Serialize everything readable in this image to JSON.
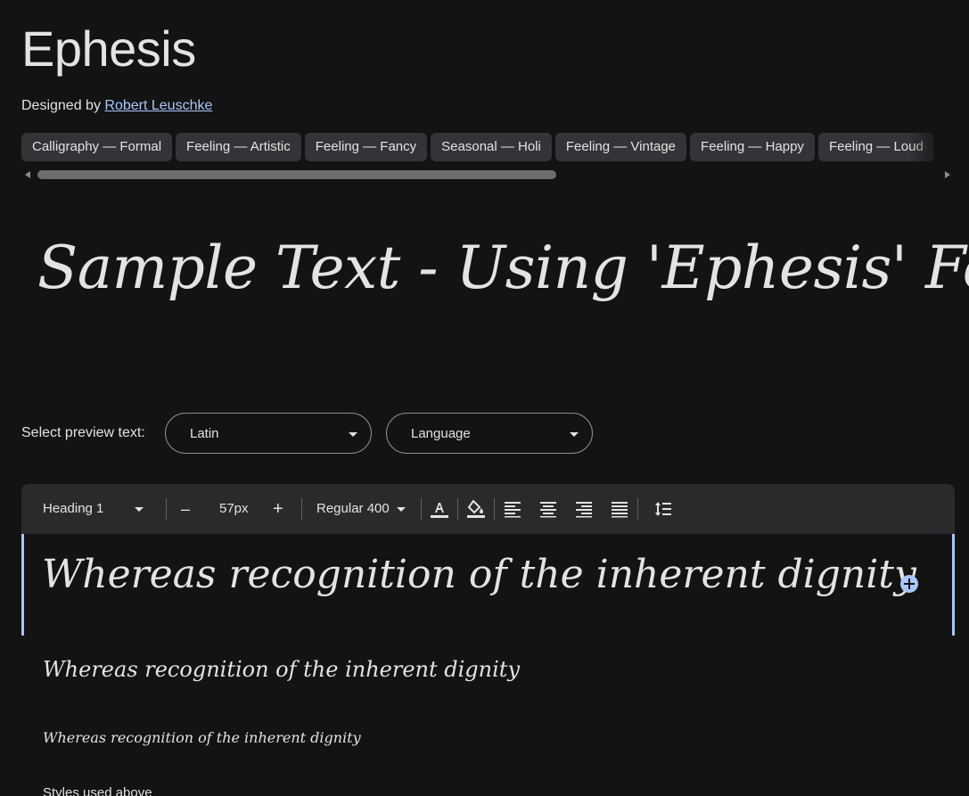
{
  "header": {
    "font_name": "Ephesis",
    "designed_by_label": "Designed by",
    "designer_name": "Robert Leuschke"
  },
  "tags": [
    "Calligraphy — Formal",
    "Feeling — Artistic",
    "Feeling — Fancy",
    "Seasonal — Holi",
    "Feeling — Vintage",
    "Feeling — Happy",
    "Feeling — Loud"
  ],
  "hero": {
    "sample_text": "Sample Text - Using 'Ephesis' Font."
  },
  "preview": {
    "label": "Select preview text:",
    "script_value": "Latin",
    "language_value": "Language"
  },
  "toolbar": {
    "style_value": "Heading 1",
    "decrease_symbol": "–",
    "size_value": "57px",
    "increase_symbol": "+",
    "weight_value": "Regular 400"
  },
  "editor": {
    "line_1": "Whereas recognition of the inherent dignity",
    "line_2": "Whereas recognition of the inherent dignity",
    "line_3": "Whereas recognition of the inherent dignity",
    "styles_label": "Styles used above"
  },
  "colors": {
    "background": "#131314",
    "text": "#e3e3e3",
    "accent": "#a8c7fa",
    "chip_bg": "#333438",
    "toolbar_bg": "#2a2a2c"
  }
}
